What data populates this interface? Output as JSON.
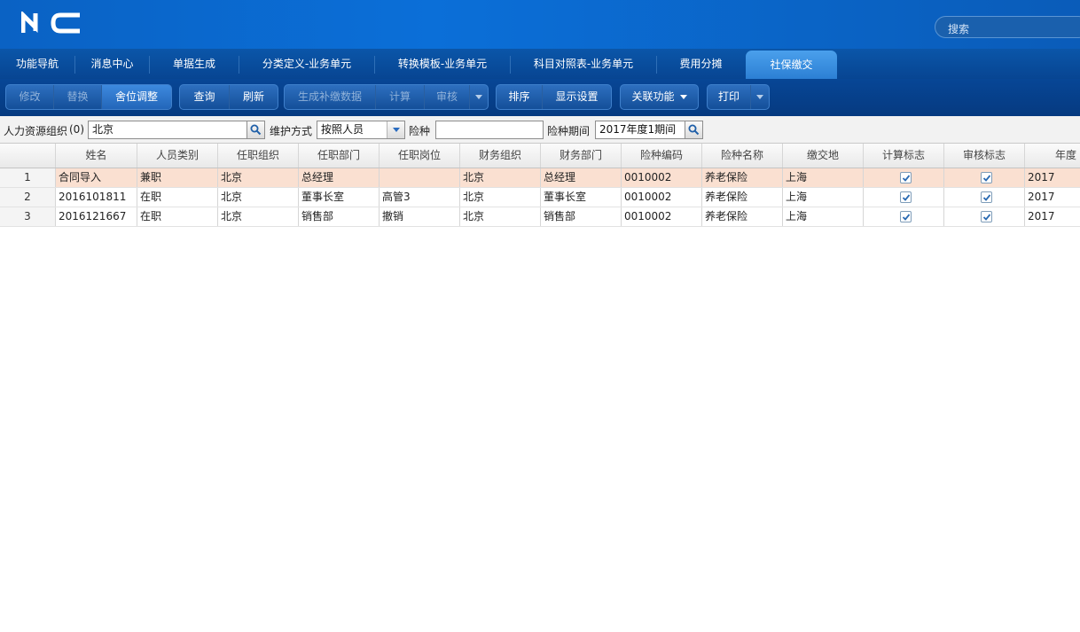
{
  "app": {
    "logo_text": "NC",
    "search_placeholder": "搜索"
  },
  "tabs": [
    {
      "label": "功能导航",
      "active": false
    },
    {
      "label": "消息中心",
      "active": false
    },
    {
      "label": "单据生成",
      "active": false
    },
    {
      "label": "分类定义-业务单元",
      "active": false
    },
    {
      "label": "转换模板-业务单元",
      "active": false
    },
    {
      "label": "科目对照表-业务单元",
      "active": false
    },
    {
      "label": "费用分摊",
      "active": false
    },
    {
      "label": "社保缴交",
      "active": true
    }
  ],
  "toolbar": {
    "modify": "修改",
    "replace": "替换",
    "adjust": "舍位调整",
    "query": "查询",
    "refresh": "刷新",
    "generate": "生成补缴数据",
    "calculate": "计算",
    "audit": "审核",
    "sort": "排序",
    "display_settings": "显示设置",
    "related": "关联功能",
    "print": "打印"
  },
  "filters": {
    "org_label": "人力资源组织",
    "org_shortcut": "(0)",
    "org_value": "北京",
    "mode_label": "维护方式",
    "mode_value": "按照人员",
    "insurance_label": "险种",
    "insurance_value": "",
    "period_label": "险种期间",
    "period_value": "2017年度1期间"
  },
  "table": {
    "columns": [
      "姓名",
      "人员类别",
      "任职组织",
      "任职部门",
      "任职岗位",
      "财务组织",
      "财务部门",
      "险种编码",
      "险种名称",
      "缴交地",
      "计算标志",
      "审核标志",
      "年度"
    ],
    "rows": [
      {
        "num": "1",
        "name": "合同导入",
        "category": "兼职",
        "org": "北京",
        "dept": "总经理",
        "post": "",
        "fin_org": "北京",
        "fin_dept": "总经理",
        "code": "0010002",
        "ins_name": "养老保险",
        "place": "上海",
        "calc": true,
        "audit": true,
        "year": "2017",
        "selected": true
      },
      {
        "num": "2",
        "name": "2016101811",
        "category": "在职",
        "org": "北京",
        "dept": "董事长室",
        "post": "高管3",
        "fin_org": "北京",
        "fin_dept": "董事长室",
        "code": "0010002",
        "ins_name": "养老保险",
        "place": "上海",
        "calc": true,
        "audit": true,
        "year": "2017",
        "selected": false
      },
      {
        "num": "3",
        "name": "2016121667",
        "category": "在职",
        "org": "北京",
        "dept": "销售部",
        "post": "撤销",
        "fin_org": "北京",
        "fin_dept": "销售部",
        "code": "0010002",
        "ins_name": "养老保险",
        "place": "上海",
        "calc": true,
        "audit": true,
        "year": "2017",
        "selected": false
      }
    ]
  }
}
